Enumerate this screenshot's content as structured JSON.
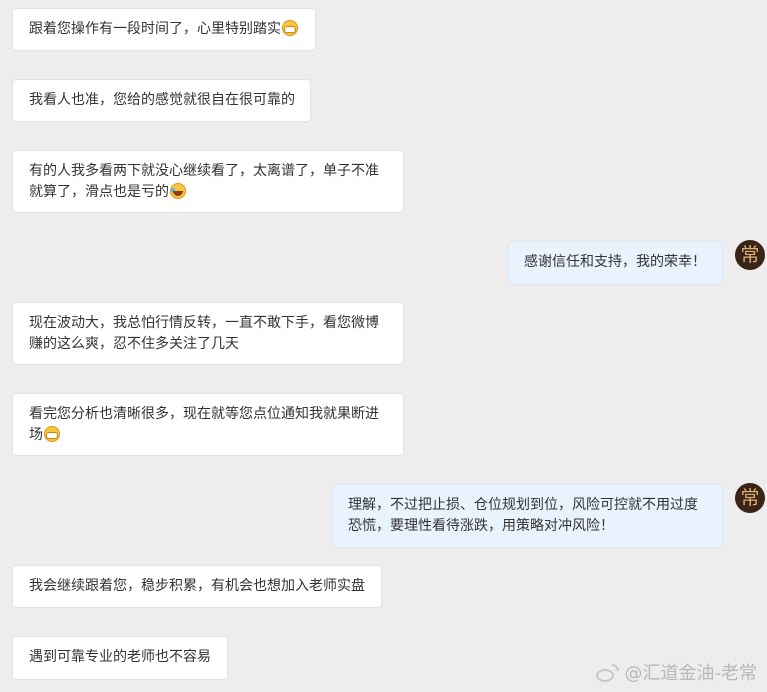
{
  "messages": [
    {
      "lines": [
        "跟着您操作有一段时间了，心里特别踏实"
      ],
      "emoji": "grin-face"
    },
    {
      "lines": [
        "我看人也准，您给的感觉就很自在很可靠的"
      ]
    },
    {
      "lines": [
        "有的人我多看两下就没心继续看了，太离谱了，单子不准",
        "就算了，滑点也是亏的"
      ],
      "emoji": "rolling-laugh-face"
    },
    {
      "lines": [
        "感谢信任和支持，我的荣幸！"
      ],
      "sender": "me"
    },
    {
      "lines": [
        "现在波动大，我总怕行情反转，一直不敢下手，看您微博",
        "赚的这么爽，忍不住多关注了几天"
      ]
    },
    {
      "lines": [
        "看完您分析也清晰很多，现在就等您点位通知我就果断进",
        "场"
      ],
      "emoji": "grin-face"
    },
    {
      "lines": [
        "理解，不过把止损、仓位规划到位，风险可控就不用过度",
        "恐慌，要理性看待涨跌，用策略对冲风险！"
      ],
      "sender": "me"
    },
    {
      "lines": [
        "我会继续跟着您，稳步积累，有机会也想加入老师实盘"
      ]
    },
    {
      "lines": [
        "遇到可靠专业的老师也不容易"
      ]
    }
  ],
  "avatar": {
    "glyph": "常"
  },
  "watermark": {
    "text": "@汇道金油-老常",
    "icon": "weibo-icon"
  },
  "colors": {
    "background": "#ededed",
    "incoming_bubble": "#ffffff",
    "outgoing_bubble": "#e8f3fd",
    "avatar_bg": "#3a2418",
    "avatar_glyph": "#d9b072"
  }
}
